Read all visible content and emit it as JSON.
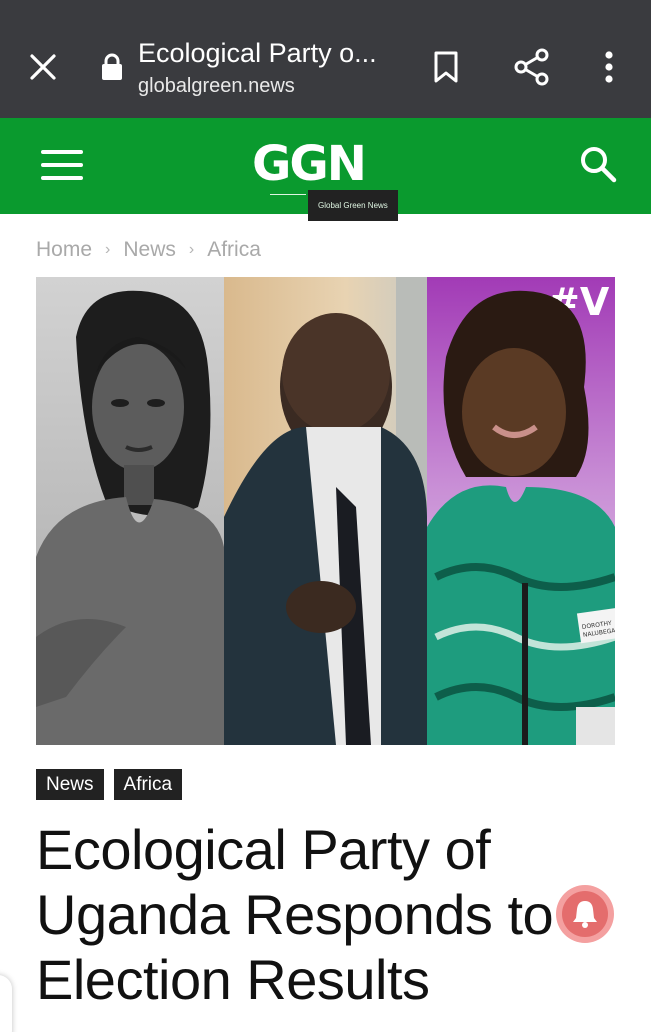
{
  "browser": {
    "title": "Ecological Party o...",
    "url": "globalgreen.news",
    "icons": {
      "close": "close-icon",
      "lock": "lock-icon",
      "bookmark": "bookmark-icon",
      "share": "share-icon",
      "more": "more-vert-icon"
    }
  },
  "site": {
    "logo_text": "GGN",
    "logo_tagline": "Global Green News",
    "brand_color": "#0a9a2e"
  },
  "breadcrumb": [
    "Home",
    "News",
    "Africa"
  ],
  "hero": {
    "banner_text": "#V",
    "badge_line1": "DOROTHY",
    "badge_line2": "NALUBEGA"
  },
  "tags": [
    "News",
    "Africa"
  ],
  "headline": "Ecological Party of Uganda Responds to Election Results",
  "colors": {
    "chrome": "#3a3b3f",
    "tag_bg": "#222222",
    "bell": "#e46d6d"
  }
}
